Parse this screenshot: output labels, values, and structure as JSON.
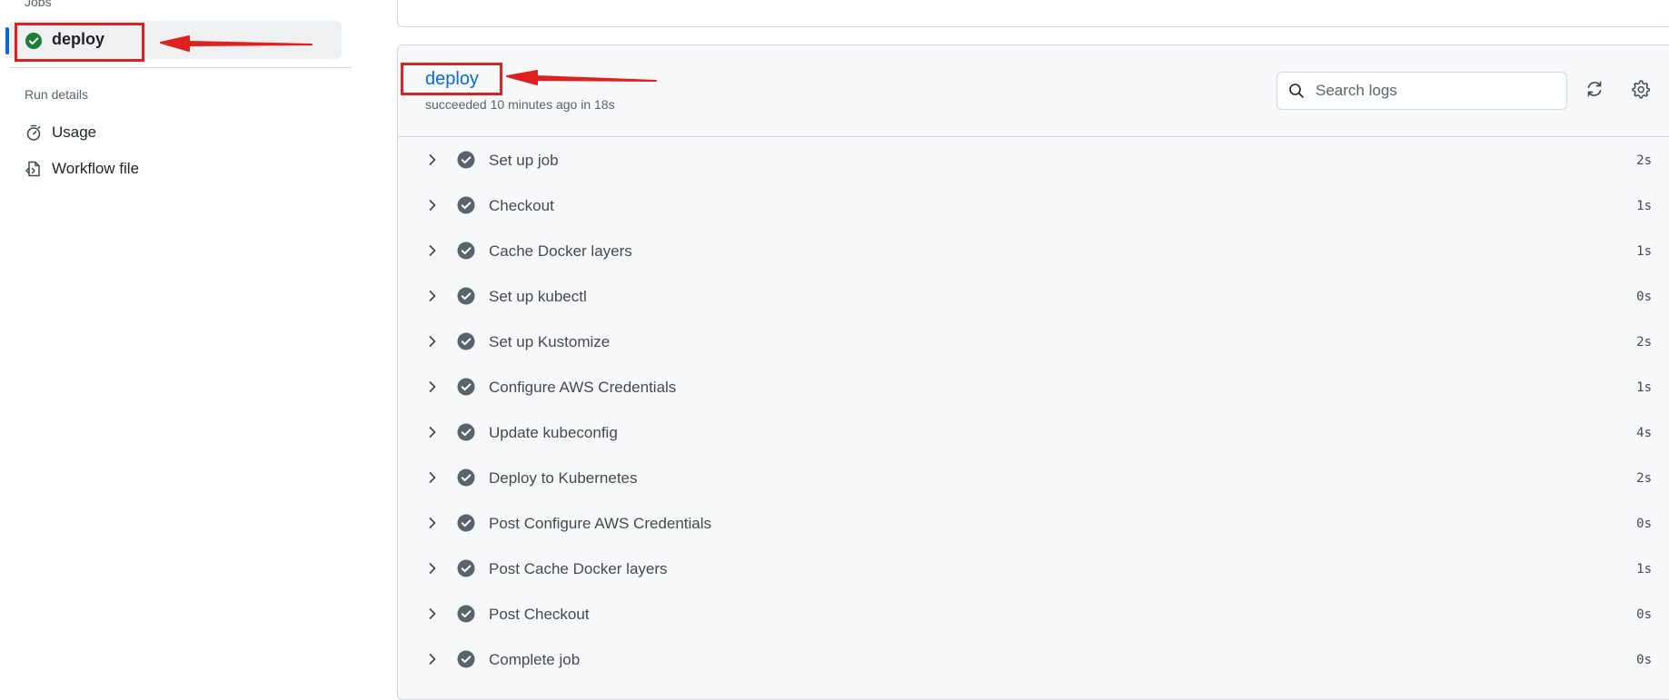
{
  "sidebar": {
    "jobs_heading": "Jobs",
    "job": {
      "label": "deploy",
      "status": "success"
    },
    "run_details_heading": "Run details",
    "links": [
      {
        "label": "Usage",
        "icon": "stopwatch-icon"
      },
      {
        "label": "Workflow file",
        "icon": "file-code-icon"
      }
    ]
  },
  "job": {
    "title": "deploy",
    "meta": "succeeded 10 minutes ago in 18s"
  },
  "search": {
    "placeholder": "Search logs"
  },
  "steps": [
    {
      "label": "Set up job",
      "duration": "2s"
    },
    {
      "label": "Checkout",
      "duration": "1s"
    },
    {
      "label": "Cache Docker layers",
      "duration": "1s"
    },
    {
      "label": "Set up kubectl",
      "duration": "0s"
    },
    {
      "label": "Set up Kustomize",
      "duration": "2s"
    },
    {
      "label": "Configure AWS Credentials",
      "duration": "1s"
    },
    {
      "label": "Update kubeconfig",
      "duration": "4s"
    },
    {
      "label": "Deploy to Kubernetes",
      "duration": "2s"
    },
    {
      "label": "Post Configure AWS Credentials",
      "duration": "0s"
    },
    {
      "label": "Post Cache Docker layers",
      "duration": "1s"
    },
    {
      "label": "Post Checkout",
      "duration": "0s"
    },
    {
      "label": "Complete job",
      "duration": "0s"
    }
  ],
  "colors": {
    "success_green": "#1a7f37",
    "step_check_gray": "#59636e",
    "link_blue": "#0969da",
    "annotation_red": "#e0201f"
  }
}
